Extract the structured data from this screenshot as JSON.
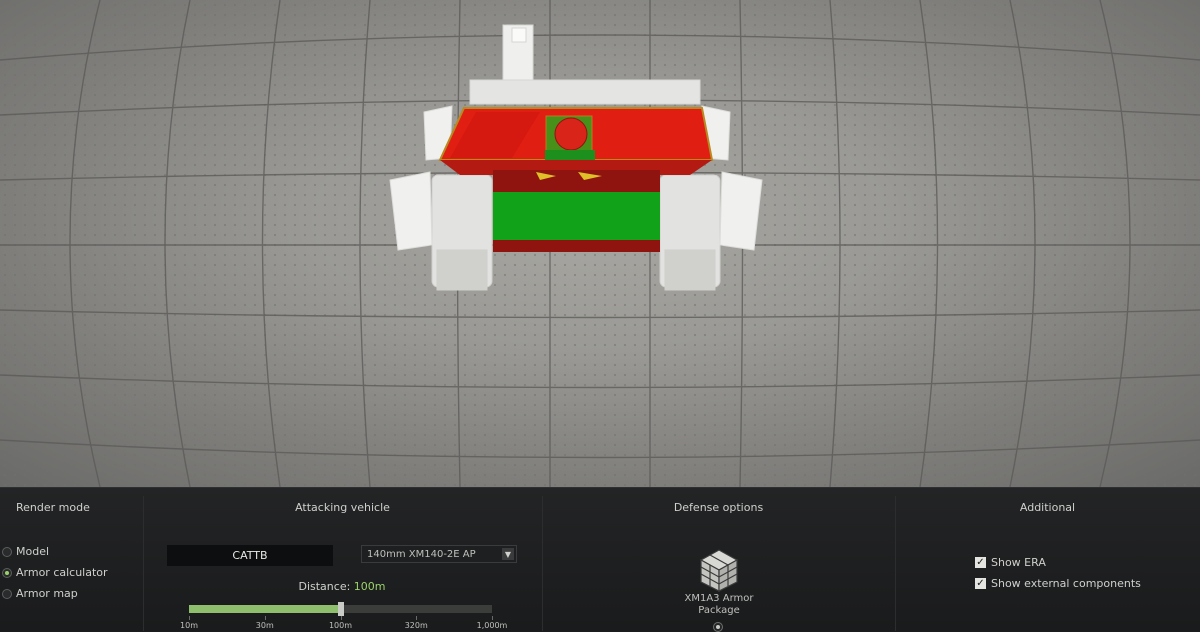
{
  "render_mode": {
    "heading": "Render mode",
    "options": [
      {
        "label": "Model",
        "selected": false
      },
      {
        "label": "Armor calculator",
        "selected": true
      },
      {
        "label": "Armor map",
        "selected": false
      }
    ]
  },
  "attacking_vehicle": {
    "heading": "Attacking vehicle",
    "vehicle": "CATTB",
    "ammo": "140mm XM140-2E AP",
    "distance_label": "Distance:",
    "distance_value": "100m",
    "slider_fraction": 0.5,
    "ticks": [
      "10m",
      "30m",
      "100m",
      "320m",
      "1,000m"
    ]
  },
  "defense_options": {
    "heading": "Defense options",
    "package_label": "XM1A3 Armor Package",
    "package_icon": "armor-plates-icon"
  },
  "additional": {
    "heading": "Additional",
    "options": [
      {
        "label": "Show ERA",
        "checked": true
      },
      {
        "label": "Show external components",
        "checked": true
      }
    ]
  },
  "colors": {
    "accent": "#9bd36a",
    "armor_red": "#e01e12",
    "armor_green": "#12a21a",
    "armor_dark_red": "#8f1410"
  }
}
